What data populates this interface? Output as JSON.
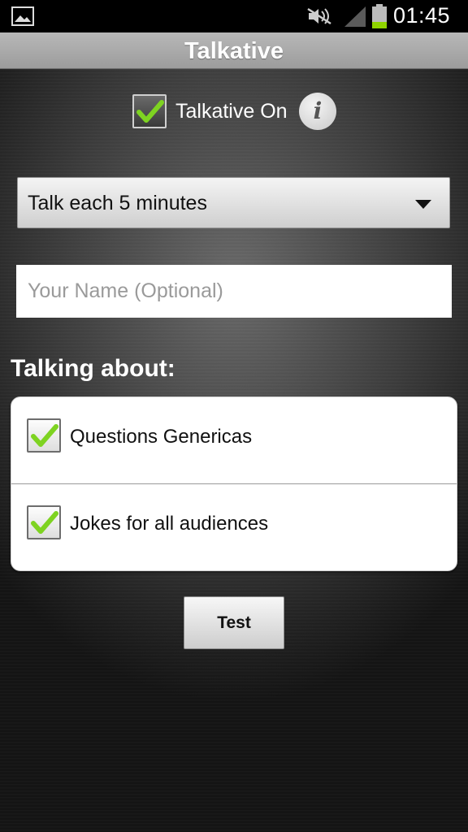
{
  "status_bar": {
    "time": "01:45",
    "icons": [
      "gallery-notification-icon",
      "mute-icon",
      "signal-icon",
      "battery-icon"
    ],
    "battery_color": "#8fd400"
  },
  "app": {
    "title": "Talkative"
  },
  "master_toggle": {
    "label": "Talkative On",
    "checked": true,
    "info_glyph": "i"
  },
  "interval_spinner": {
    "selected": "Talk each 5 minutes"
  },
  "name_field": {
    "value": "",
    "placeholder": "Your Name (Optional)"
  },
  "topics": {
    "title": "Talking about:",
    "items": [
      {
        "label": "Questions Genericas",
        "checked": true
      },
      {
        "label": "Jokes for all audiences",
        "checked": true
      }
    ]
  },
  "test_button": {
    "label": "Test"
  },
  "colors": {
    "check_green": "#7ed321",
    "title_bar": "#a9a9a9"
  }
}
